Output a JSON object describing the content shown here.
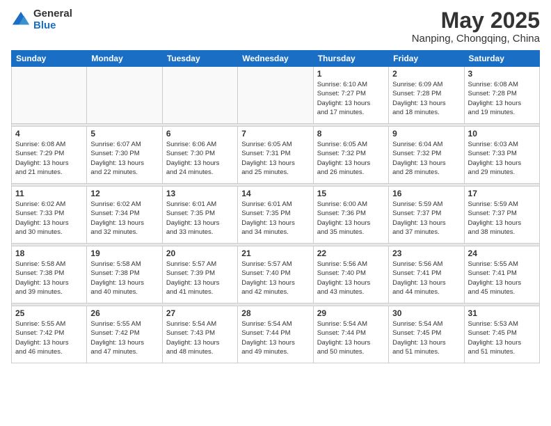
{
  "header": {
    "logo_general": "General",
    "logo_blue": "Blue",
    "month_title": "May 2025",
    "location": "Nanping, Chongqing, China"
  },
  "days_of_week": [
    "Sunday",
    "Monday",
    "Tuesday",
    "Wednesday",
    "Thursday",
    "Friday",
    "Saturday"
  ],
  "weeks": [
    [
      {
        "day": "",
        "info": ""
      },
      {
        "day": "",
        "info": ""
      },
      {
        "day": "",
        "info": ""
      },
      {
        "day": "",
        "info": ""
      },
      {
        "day": "1",
        "info": "Sunrise: 6:10 AM\nSunset: 7:27 PM\nDaylight: 13 hours\nand 17 minutes."
      },
      {
        "day": "2",
        "info": "Sunrise: 6:09 AM\nSunset: 7:28 PM\nDaylight: 13 hours\nand 18 minutes."
      },
      {
        "day": "3",
        "info": "Sunrise: 6:08 AM\nSunset: 7:28 PM\nDaylight: 13 hours\nand 19 minutes."
      }
    ],
    [
      {
        "day": "4",
        "info": "Sunrise: 6:08 AM\nSunset: 7:29 PM\nDaylight: 13 hours\nand 21 minutes."
      },
      {
        "day": "5",
        "info": "Sunrise: 6:07 AM\nSunset: 7:30 PM\nDaylight: 13 hours\nand 22 minutes."
      },
      {
        "day": "6",
        "info": "Sunrise: 6:06 AM\nSunset: 7:30 PM\nDaylight: 13 hours\nand 24 minutes."
      },
      {
        "day": "7",
        "info": "Sunrise: 6:05 AM\nSunset: 7:31 PM\nDaylight: 13 hours\nand 25 minutes."
      },
      {
        "day": "8",
        "info": "Sunrise: 6:05 AM\nSunset: 7:32 PM\nDaylight: 13 hours\nand 26 minutes."
      },
      {
        "day": "9",
        "info": "Sunrise: 6:04 AM\nSunset: 7:32 PM\nDaylight: 13 hours\nand 28 minutes."
      },
      {
        "day": "10",
        "info": "Sunrise: 6:03 AM\nSunset: 7:33 PM\nDaylight: 13 hours\nand 29 minutes."
      }
    ],
    [
      {
        "day": "11",
        "info": "Sunrise: 6:02 AM\nSunset: 7:33 PM\nDaylight: 13 hours\nand 30 minutes."
      },
      {
        "day": "12",
        "info": "Sunrise: 6:02 AM\nSunset: 7:34 PM\nDaylight: 13 hours\nand 32 minutes."
      },
      {
        "day": "13",
        "info": "Sunrise: 6:01 AM\nSunset: 7:35 PM\nDaylight: 13 hours\nand 33 minutes."
      },
      {
        "day": "14",
        "info": "Sunrise: 6:01 AM\nSunset: 7:35 PM\nDaylight: 13 hours\nand 34 minutes."
      },
      {
        "day": "15",
        "info": "Sunrise: 6:00 AM\nSunset: 7:36 PM\nDaylight: 13 hours\nand 35 minutes."
      },
      {
        "day": "16",
        "info": "Sunrise: 5:59 AM\nSunset: 7:37 PM\nDaylight: 13 hours\nand 37 minutes."
      },
      {
        "day": "17",
        "info": "Sunrise: 5:59 AM\nSunset: 7:37 PM\nDaylight: 13 hours\nand 38 minutes."
      }
    ],
    [
      {
        "day": "18",
        "info": "Sunrise: 5:58 AM\nSunset: 7:38 PM\nDaylight: 13 hours\nand 39 minutes."
      },
      {
        "day": "19",
        "info": "Sunrise: 5:58 AM\nSunset: 7:38 PM\nDaylight: 13 hours\nand 40 minutes."
      },
      {
        "day": "20",
        "info": "Sunrise: 5:57 AM\nSunset: 7:39 PM\nDaylight: 13 hours\nand 41 minutes."
      },
      {
        "day": "21",
        "info": "Sunrise: 5:57 AM\nSunset: 7:40 PM\nDaylight: 13 hours\nand 42 minutes."
      },
      {
        "day": "22",
        "info": "Sunrise: 5:56 AM\nSunset: 7:40 PM\nDaylight: 13 hours\nand 43 minutes."
      },
      {
        "day": "23",
        "info": "Sunrise: 5:56 AM\nSunset: 7:41 PM\nDaylight: 13 hours\nand 44 minutes."
      },
      {
        "day": "24",
        "info": "Sunrise: 5:55 AM\nSunset: 7:41 PM\nDaylight: 13 hours\nand 45 minutes."
      }
    ],
    [
      {
        "day": "25",
        "info": "Sunrise: 5:55 AM\nSunset: 7:42 PM\nDaylight: 13 hours\nand 46 minutes."
      },
      {
        "day": "26",
        "info": "Sunrise: 5:55 AM\nSunset: 7:42 PM\nDaylight: 13 hours\nand 47 minutes."
      },
      {
        "day": "27",
        "info": "Sunrise: 5:54 AM\nSunset: 7:43 PM\nDaylight: 13 hours\nand 48 minutes."
      },
      {
        "day": "28",
        "info": "Sunrise: 5:54 AM\nSunset: 7:44 PM\nDaylight: 13 hours\nand 49 minutes."
      },
      {
        "day": "29",
        "info": "Sunrise: 5:54 AM\nSunset: 7:44 PM\nDaylight: 13 hours\nand 50 minutes."
      },
      {
        "day": "30",
        "info": "Sunrise: 5:54 AM\nSunset: 7:45 PM\nDaylight: 13 hours\nand 51 minutes."
      },
      {
        "day": "31",
        "info": "Sunrise: 5:53 AM\nSunset: 7:45 PM\nDaylight: 13 hours\nand 51 minutes."
      }
    ]
  ]
}
